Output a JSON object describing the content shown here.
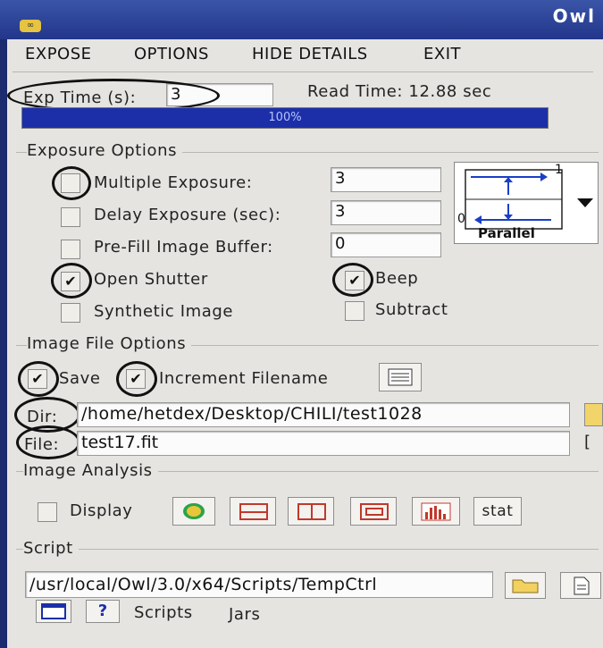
{
  "window": {
    "title": "Owl"
  },
  "menu": [
    "EXPOSE",
    "OPTIONS",
    "HIDE DETAILS",
    "EXIT"
  ],
  "expose": {
    "exp_time_label": "Exp Time (s):",
    "exp_time_value": "3",
    "read_time_label": "Read Time: 12.88 sec",
    "progress_text": "100%",
    "progress_fraction": 1.0
  },
  "exposure_options": {
    "title": "Exposure Options",
    "multiple_exposure": {
      "label": "Multiple Exposure:",
      "value": "3",
      "checked": false
    },
    "delay_exposure": {
      "label": "Delay Exposure (sec):",
      "value": "3",
      "checked": false
    },
    "prefill": {
      "label": "Pre-Fill Image Buffer:",
      "value": "0",
      "checked": false
    },
    "open_shutter": {
      "label": "Open Shutter",
      "checked": true
    },
    "beep": {
      "label": "Beep",
      "checked": true
    },
    "synthetic": {
      "label": "Synthetic Image",
      "checked": false
    },
    "subtract": {
      "label": "Subtract",
      "checked": false
    },
    "readout_label": "Parallel",
    "readout_marks": {
      "one": "1",
      "zero": "0"
    }
  },
  "image_file_options": {
    "title": "Image File Options",
    "save": {
      "label": "Save",
      "checked": true
    },
    "increment": {
      "label": "Increment Filename",
      "checked": true
    },
    "dir_label": "Dir:",
    "dir_value": "/home/hetdex/Desktop/CHILI/test1028",
    "file_label": "File:",
    "file_value": "test17.fit",
    "file_bracket": "["
  },
  "image_analysis": {
    "title": "Image Analysis",
    "display_label": "Display",
    "stat_label": "stat"
  },
  "script": {
    "title": "Script",
    "path": "/usr/local/Owl/3.0/x64/Scripts/TempCtrl",
    "scripts_label": "Scripts",
    "jars_label": "Jars"
  },
  "colors": {
    "progress": "#1c2fa8",
    "panel": "#e6e4e1",
    "title_bar": "#2b41a0"
  }
}
